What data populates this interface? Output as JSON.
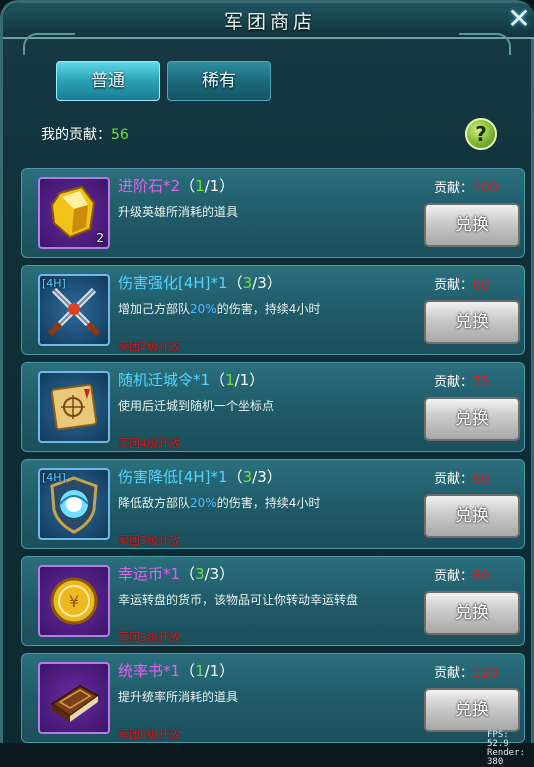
{
  "window": {
    "title": "军团商店"
  },
  "tabs": [
    {
      "label": "普通",
      "active": true
    },
    {
      "label": "稀有",
      "active": false
    }
  ],
  "contribution": {
    "label": "我的贡献：",
    "value": "56"
  },
  "items": [
    {
      "icon": "gold-stone-icon",
      "quantity": "2",
      "name": "进阶石*2",
      "limit_used": "1",
      "limit_total": "1",
      "desc": "升级英雄所消耗的道具",
      "requirement": "",
      "cost_label": "贡献：",
      "cost": "100",
      "button": "兑换"
    },
    {
      "icon": "crossed-swords-icon",
      "tag": "[4H]",
      "name": "伤害强化[4H]*1",
      "limit_used": "3",
      "limit_total": "3",
      "desc_pre": "增加己方部队",
      "desc_pct": "20%",
      "desc_post": "的伤害，持续4小时",
      "requirement": "军团2级开放",
      "cost_label": "贡献：",
      "cost": "60",
      "button": "兑换"
    },
    {
      "icon": "scroll-map-icon",
      "name": "随机迁城令*1",
      "limit_used": "1",
      "limit_total": "1",
      "desc": "使用后迁城到随机一个坐标点",
      "requirement": "军团4级开放",
      "cost_label": "贡献：",
      "cost": "75",
      "button": "兑换"
    },
    {
      "icon": "vortex-shield-icon",
      "tag": "[4H]",
      "name": "伤害降低[4H]*1",
      "limit_used": "3",
      "limit_total": "3",
      "desc_pre": "降低敌方部队",
      "desc_pct": "20%",
      "desc_post": "的伤害，持续4小时",
      "requirement": "军团3级开放",
      "cost_label": "贡献：",
      "cost": "60",
      "button": "兑换"
    },
    {
      "icon": "lucky-coin-icon",
      "name": "幸运币*1",
      "limit_used": "3",
      "limit_total": "3",
      "desc": "幸运转盘的货币，该物品可让你转动幸运转盘",
      "requirement": "军团5级开放",
      "cost_label": "贡献：",
      "cost": "60",
      "button": "兑换"
    },
    {
      "icon": "command-book-icon",
      "name": "统率书*1",
      "limit_used": "1",
      "limit_total": "1",
      "desc": "提升统率所消耗的道具",
      "requirement": "军团6级开放",
      "cost_label": "贡献：",
      "cost": "120",
      "button": "兑换"
    }
  ],
  "debug": {
    "fps": "FPS: 52.9",
    "render": "Render: 380"
  }
}
